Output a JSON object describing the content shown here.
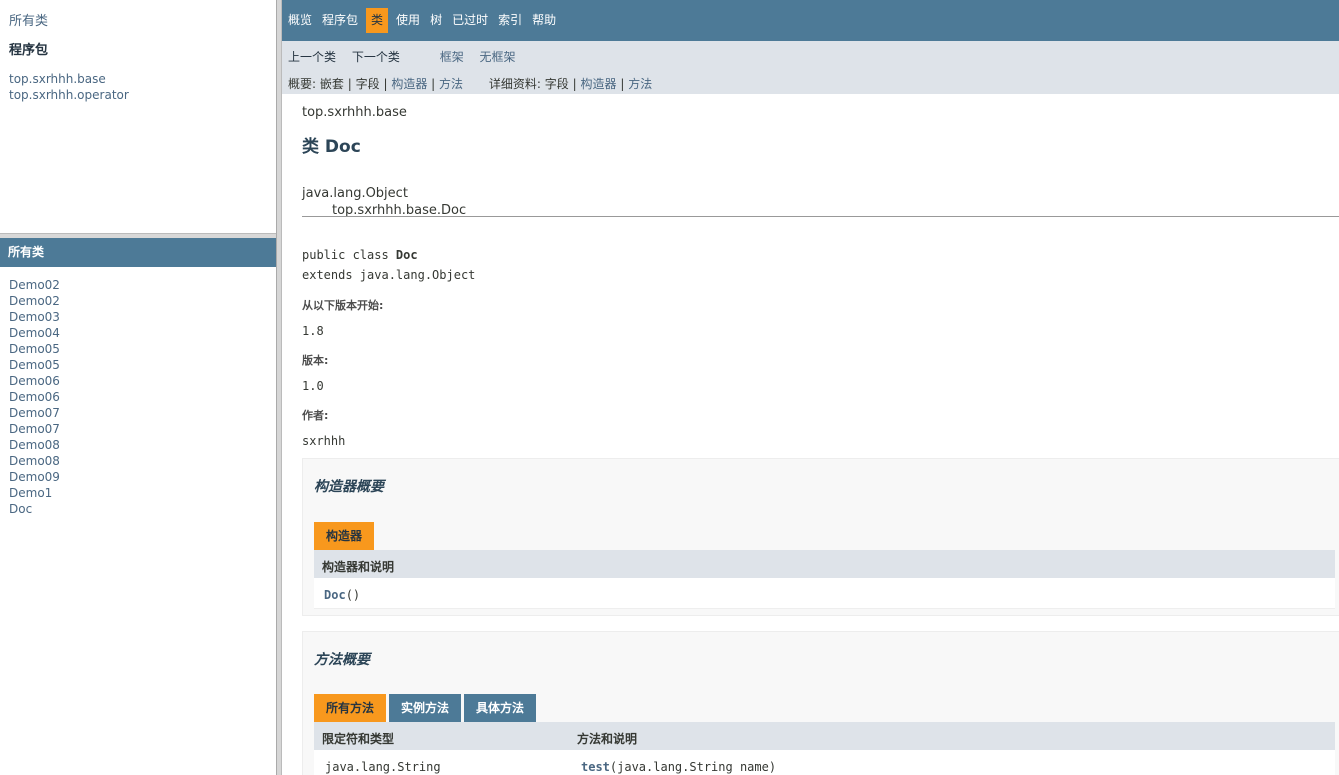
{
  "package_frame": {
    "all_classes_link": "所有类",
    "heading": "程序包",
    "packages": [
      "top.sxrhhh.base",
      "top.sxrhhh.operator"
    ]
  },
  "classes_frame": {
    "heading": "所有类",
    "classes": [
      "Demo02",
      "Demo02",
      "Demo03",
      "Demo04",
      "Demo05",
      "Demo05",
      "Demo06",
      "Demo06",
      "Demo07",
      "Demo07",
      "Demo08",
      "Demo08",
      "Demo09",
      "Demo1",
      "Doc"
    ]
  },
  "topnav": {
    "items": [
      {
        "label": "概览",
        "active": false
      },
      {
        "label": "程序包",
        "active": false
      },
      {
        "label": "类",
        "active": true
      },
      {
        "label": "使用",
        "active": false
      },
      {
        "label": "树",
        "active": false
      },
      {
        "label": "已过时",
        "active": false
      },
      {
        "label": "索引",
        "active": false
      },
      {
        "label": "帮助",
        "active": false
      }
    ]
  },
  "subnav": {
    "prev_class": "上一个类",
    "next_class": "下一个类",
    "frames": "框架",
    "no_frames": "无框架",
    "summary_label": "概要:",
    "summary_nested": "嵌套",
    "summary_field": "字段",
    "summary_constructor": "构造器",
    "summary_method": "方法",
    "detail_label": "详细资料:",
    "detail_field": "字段",
    "detail_constructor": "构造器",
    "detail_method": "方法",
    "separator": "|"
  },
  "header": {
    "package": "top.sxrhhh.base",
    "title": "类 Doc",
    "parent_class": "java.lang.Object",
    "this_class": "top.sxrhhh.base.Doc"
  },
  "declaration": {
    "line1_prefix": "public class ",
    "line1_name": "Doc",
    "line2": "extends java.lang.Object"
  },
  "tags": {
    "since_label": "从以下版本开始:",
    "since_value": "1.8",
    "version_label": "版本:",
    "version_value": "1.0",
    "author_label": "作者:",
    "author_value": "sxrhhh"
  },
  "constructor_summary": {
    "heading": "构造器概要",
    "tab": "构造器",
    "column": "构造器和说明",
    "rows": [
      {
        "name": "Doc",
        "params": "()"
      }
    ]
  },
  "method_summary": {
    "heading": "方法概要",
    "tabs": [
      {
        "label": "所有方法",
        "active": true
      },
      {
        "label": "实例方法",
        "active": false
      },
      {
        "label": "具体方法",
        "active": false
      }
    ],
    "col_modifier": "限定符和类型",
    "col_method": "方法和说明",
    "rows": [
      {
        "type": "java.lang.String",
        "name": "test",
        "params": "(java.lang.String  name)"
      }
    ]
  },
  "colors": {
    "nav_bar": "#4D7A97",
    "active_tab": "#F8981D",
    "subnav_bg": "#dee3e9",
    "link": "#4A6782"
  }
}
